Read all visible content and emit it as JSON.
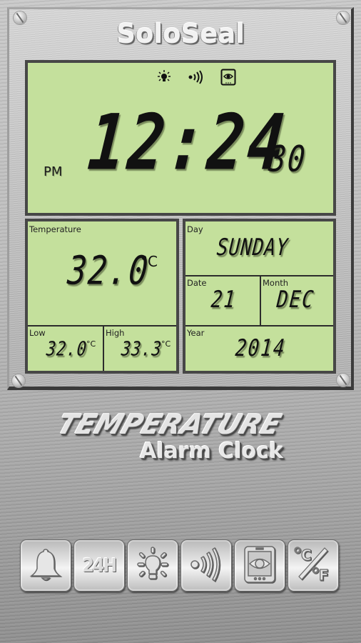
{
  "app": {
    "brand": "SoloSeal"
  },
  "status_bar_icons": [
    "light-bulb-icon",
    "sound-wave-icon",
    "screen-eye-icon"
  ],
  "clock": {
    "ampm": "PM",
    "time": "12:24",
    "seconds": "30"
  },
  "temperature": {
    "label": "Temperature",
    "value": "32.0",
    "unit": "°C",
    "low": {
      "label": "Low",
      "value": "32.0",
      "unit": "°C"
    },
    "high": {
      "label": "High",
      "value": "33.3",
      "unit": "°C"
    }
  },
  "calendar": {
    "day": {
      "label": "Day",
      "value": "SUNDAY"
    },
    "date": {
      "label": "Date",
      "value": "21"
    },
    "month": {
      "label": "Month",
      "value": "DEC"
    },
    "year": {
      "label": "Year",
      "value": "2014"
    }
  },
  "logo": {
    "line1": "TEMPERATURE",
    "line2": "Alarm Clock"
  },
  "toolbar": {
    "buttons": [
      {
        "name": "alarm",
        "icon": "bell-icon"
      },
      {
        "name": "24h-format",
        "label": "24H"
      },
      {
        "name": "light",
        "icon": "light-bulb-icon"
      },
      {
        "name": "sound",
        "icon": "sound-wave-icon"
      },
      {
        "name": "screen-always-on",
        "icon": "screen-eye-icon"
      },
      {
        "name": "celsius-fahrenheit",
        "icon": "celsius-fahrenheit-icon",
        "label": "°C/°F"
      }
    ]
  },
  "colors": {
    "lcd_background": "#c4e09c",
    "lcd_text": "#111111",
    "metal": "#c4c4c4"
  }
}
